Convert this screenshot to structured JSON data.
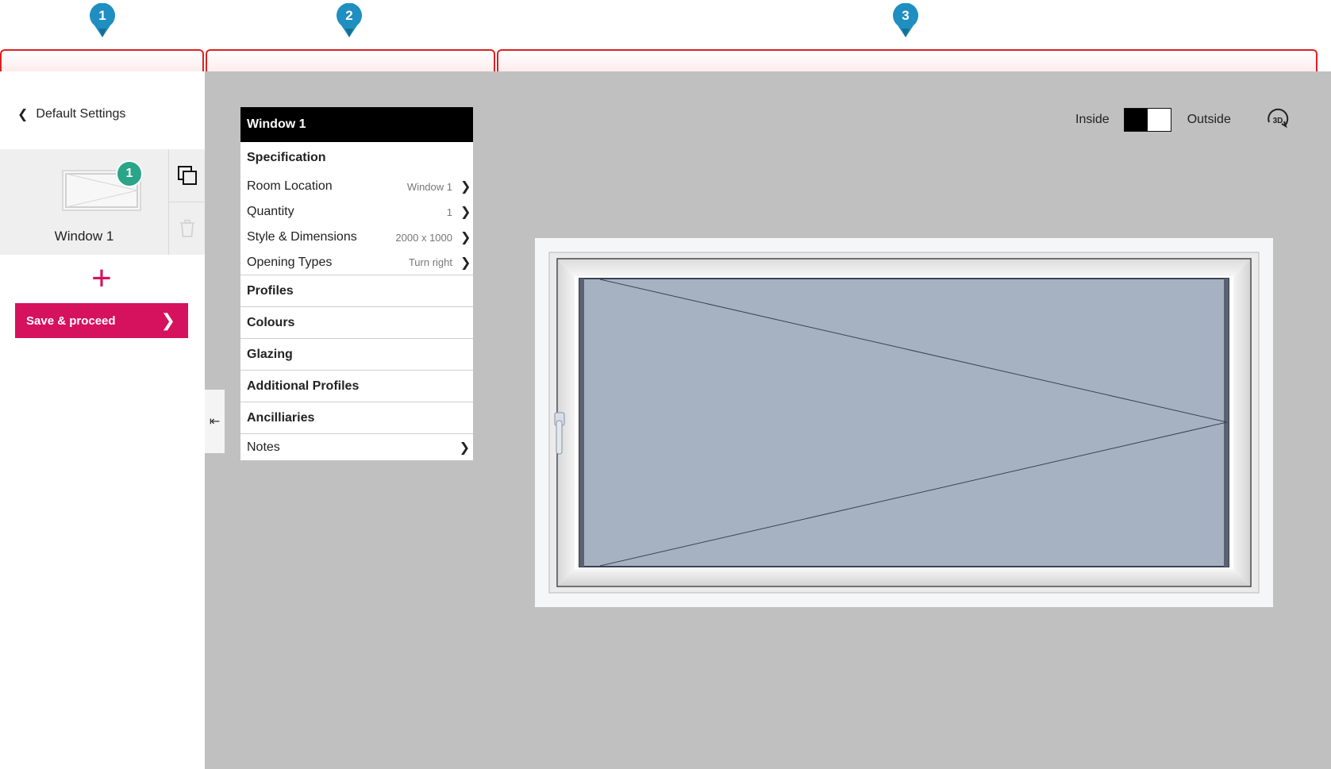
{
  "annotations": {
    "pins": [
      {
        "label": "1"
      },
      {
        "label": "2"
      },
      {
        "label": "3"
      }
    ],
    "pin_color": "#1e8fc0",
    "bracket_color": "#e02020"
  },
  "sidebar": {
    "back_label": "Default Settings",
    "items": [
      {
        "title": "Window 1",
        "badge": "1"
      }
    ],
    "save_label": "Save & proceed"
  },
  "menu": {
    "title": "Window 1",
    "specification": {
      "heading": "Specification",
      "rows": [
        {
          "label": "Room Location",
          "value": "Window 1"
        },
        {
          "label": "Quantity",
          "value": "1"
        },
        {
          "label": "Style & Dimensions",
          "value": "2000 x 1000"
        },
        {
          "label": "Opening Types",
          "value": "Turn right"
        }
      ]
    },
    "sections": [
      "Profiles",
      "Colours",
      "Glazing",
      "Additional Profiles",
      "Ancilliaries"
    ],
    "notes_label": "Notes"
  },
  "view_toggle": {
    "inside_label": "Inside",
    "outside_label": "Outside",
    "icon_3d_label": "3D"
  },
  "colors": {
    "accent": "#d6115e",
    "badge": "#2aa587",
    "canvas": "#c0c0c0",
    "glass": "#a6b1c2"
  }
}
